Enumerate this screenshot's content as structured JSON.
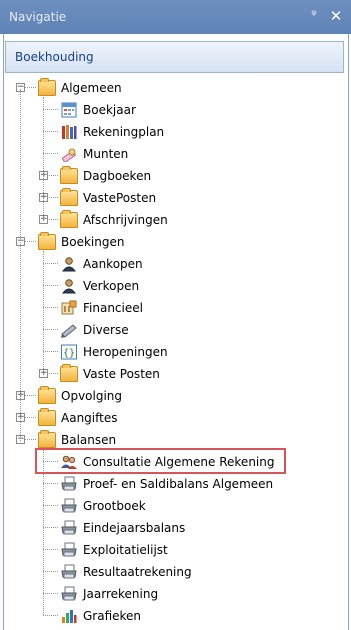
{
  "window": {
    "title": "Navigatie",
    "pin_glyph": "ᵠ",
    "close_glyph": "✕"
  },
  "tab": {
    "label": "Boekhouding"
  },
  "tree": [
    {
      "label": "Algemeen",
      "icon": "folder-icon",
      "level": 0,
      "expander": "−"
    },
    {
      "label": "Boekjaar",
      "icon": "calendar-icon",
      "level": 1
    },
    {
      "label": "Rekeningplan",
      "icon": "books-icon",
      "level": 1
    },
    {
      "label": "Munten",
      "icon": "coins-icon",
      "level": 1
    },
    {
      "label": "Dagboeken",
      "icon": "folder-icon",
      "level": 1,
      "expander": "+"
    },
    {
      "label": "VastePosten",
      "icon": "folder-icon",
      "level": 1,
      "expander": "+"
    },
    {
      "label": "Afschrijvingen",
      "icon": "folder-icon",
      "level": 1,
      "expander": "+"
    },
    {
      "label": "Boekingen",
      "icon": "folder-icon",
      "level": 0,
      "expander": "−"
    },
    {
      "label": "Aankopen",
      "icon": "person-icon",
      "level": 1
    },
    {
      "label": "Verkopen",
      "icon": "person-icon",
      "level": 1
    },
    {
      "label": "Financieel",
      "icon": "bank-icon",
      "level": 1
    },
    {
      "label": "Diverse",
      "icon": "pen-icon",
      "level": 1
    },
    {
      "label": "Heropeningen",
      "icon": "braces-icon",
      "level": 1
    },
    {
      "label": "Vaste Posten",
      "icon": "folder-icon",
      "level": 1,
      "expander": "+"
    },
    {
      "label": "Opvolging",
      "icon": "folder-icon",
      "level": 0,
      "expander": "+"
    },
    {
      "label": "Aangiftes",
      "icon": "folder-icon",
      "level": 0,
      "expander": "+"
    },
    {
      "label": "Balansen",
      "icon": "folder-icon",
      "level": 0,
      "expander": "−"
    },
    {
      "label": "Consultatie Algemene Rekening",
      "icon": "users-icon",
      "level": 1,
      "highlighted": true
    },
    {
      "label": "Proef- en Saldibalans Algemeen",
      "icon": "printer-icon",
      "level": 1
    },
    {
      "label": "Grootboek",
      "icon": "printer-icon",
      "level": 1
    },
    {
      "label": "Eindejaarsbalans",
      "icon": "printer-icon",
      "level": 1
    },
    {
      "label": "Exploitatielijst",
      "icon": "printer-icon",
      "level": 1
    },
    {
      "label": "Resultaatrekening",
      "icon": "printer-icon",
      "level": 1
    },
    {
      "label": "Jaarrekening",
      "icon": "printer-icon",
      "level": 1
    },
    {
      "label": "Grafieken",
      "icon": "chart-icon",
      "level": 1
    }
  ]
}
